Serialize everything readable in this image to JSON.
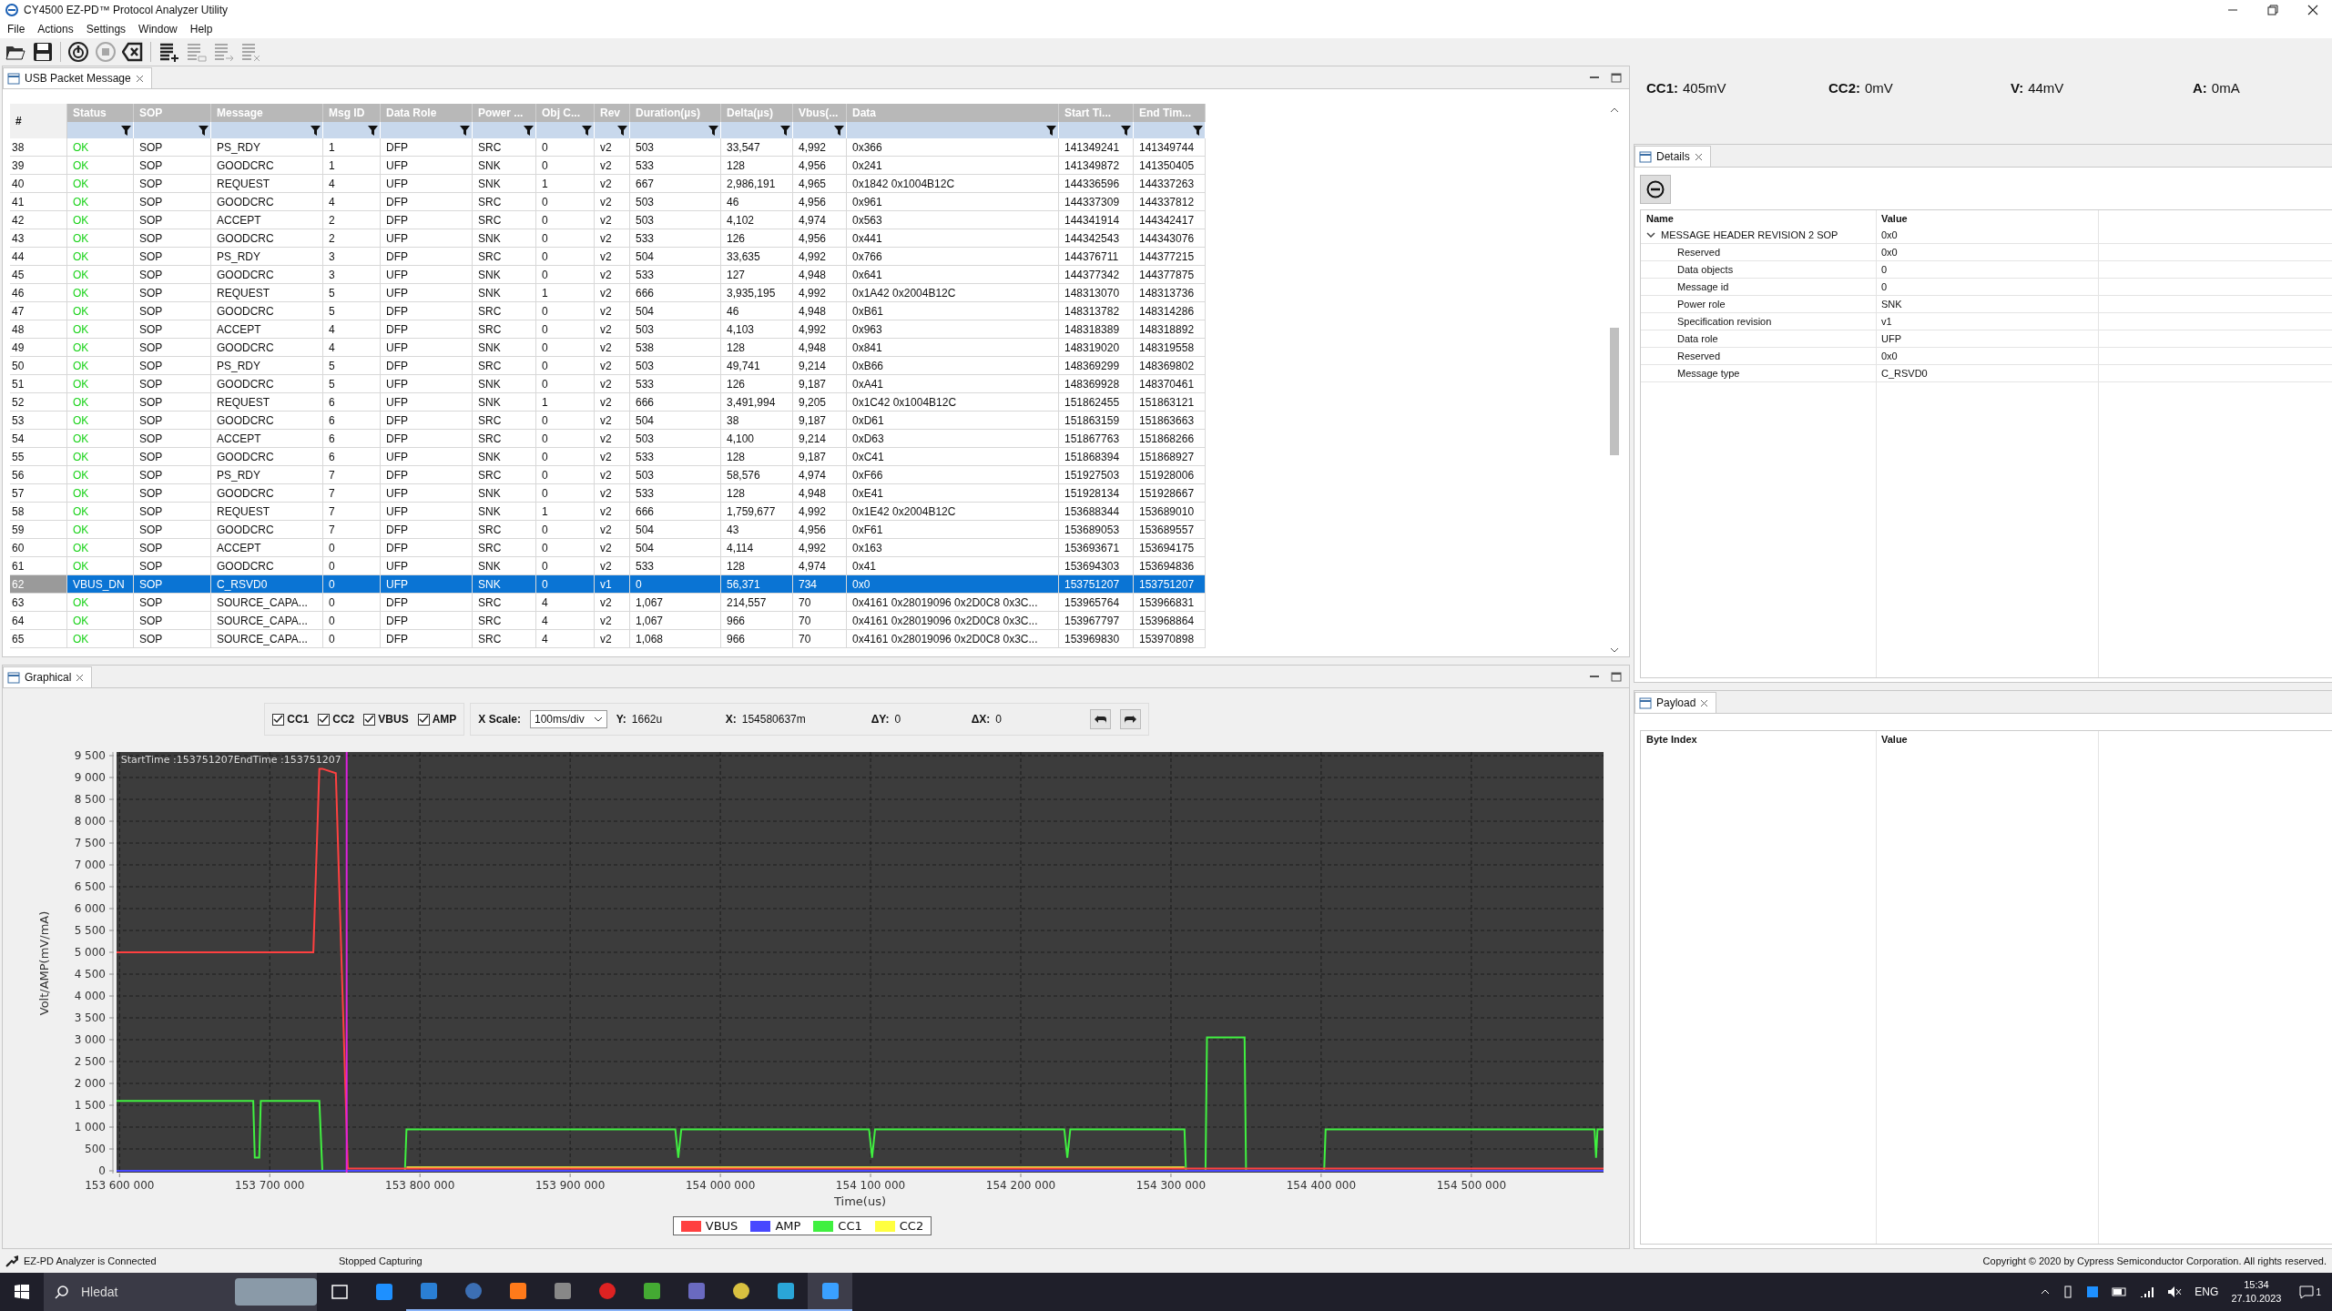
{
  "window": {
    "title": "CY4500 EZ-PD™ Protocol Analyzer Utility"
  },
  "menu": [
    "File",
    "Actions",
    "Settings",
    "Window",
    "Help"
  ],
  "toolbar": [
    {
      "disabled": false
    },
    {
      "disabled": false
    },
    {
      "disabled": false
    },
    {
      "disabled": true
    },
    {
      "disabled": false
    },
    {
      "disabled": false
    },
    {
      "disabled": true
    },
    {
      "disabled": true
    },
    {
      "disabled": true
    }
  ],
  "packet_panel": {
    "tab": "USB Packet Message",
    "table": {
      "columns": [
        "#",
        "Status",
        "SOP",
        "Message",
        "Msg ID",
        "Data Role",
        "Power ...",
        "Obj C...",
        "Rev",
        "Duration(µs)",
        "Delta(µs)",
        "Vbus(...",
        "Data",
        "Start Ti...",
        "End Tim..."
      ],
      "rows": [
        {
          "selected": false,
          "cells": [
            "38",
            "OK",
            "SOP",
            "PS_RDY",
            "1",
            "DFP",
            "SRC",
            "0",
            "v2",
            "503",
            "33,547",
            "4,992",
            "0x366",
            "141349241",
            "141349744"
          ]
        },
        {
          "selected": false,
          "cells": [
            "39",
            "OK",
            "SOP",
            "GOODCRC",
            "1",
            "UFP",
            "SNK",
            "0",
            "v2",
            "533",
            "128",
            "4,956",
            "0x241",
            "141349872",
            "141350405"
          ]
        },
        {
          "selected": false,
          "cells": [
            "40",
            "OK",
            "SOP",
            "REQUEST",
            "4",
            "UFP",
            "SNK",
            "1",
            "v2",
            "667",
            "2,986,191",
            "4,965",
            "0x1842 0x1004B12C",
            "144336596",
            "144337263"
          ]
        },
        {
          "selected": false,
          "cells": [
            "41",
            "OK",
            "SOP",
            "GOODCRC",
            "4",
            "DFP",
            "SRC",
            "0",
            "v2",
            "503",
            "46",
            "4,956",
            "0x961",
            "144337309",
            "144337812"
          ]
        },
        {
          "selected": false,
          "cells": [
            "42",
            "OK",
            "SOP",
            "ACCEPT",
            "2",
            "DFP",
            "SRC",
            "0",
            "v2",
            "503",
            "4,102",
            "4,974",
            "0x563",
            "144341914",
            "144342417"
          ]
        },
        {
          "selected": false,
          "cells": [
            "43",
            "OK",
            "SOP",
            "GOODCRC",
            "2",
            "UFP",
            "SNK",
            "0",
            "v2",
            "533",
            "126",
            "4,956",
            "0x441",
            "144342543",
            "144343076"
          ]
        },
        {
          "selected": false,
          "cells": [
            "44",
            "OK",
            "SOP",
            "PS_RDY",
            "3",
            "DFP",
            "SRC",
            "0",
            "v2",
            "504",
            "33,635",
            "4,992",
            "0x766",
            "144376711",
            "144377215"
          ]
        },
        {
          "selected": false,
          "cells": [
            "45",
            "OK",
            "SOP",
            "GOODCRC",
            "3",
            "UFP",
            "SNK",
            "0",
            "v2",
            "533",
            "127",
            "4,948",
            "0x641",
            "144377342",
            "144377875"
          ]
        },
        {
          "selected": false,
          "cells": [
            "46",
            "OK",
            "SOP",
            "REQUEST",
            "5",
            "UFP",
            "SNK",
            "1",
            "v2",
            "666",
            "3,935,195",
            "4,992",
            "0x1A42 0x2004B12C",
            "148313070",
            "148313736"
          ]
        },
        {
          "selected": false,
          "cells": [
            "47",
            "OK",
            "SOP",
            "GOODCRC",
            "5",
            "DFP",
            "SRC",
            "0",
            "v2",
            "504",
            "46",
            "4,948",
            "0xB61",
            "148313782",
            "148314286"
          ]
        },
        {
          "selected": false,
          "cells": [
            "48",
            "OK",
            "SOP",
            "ACCEPT",
            "4",
            "DFP",
            "SRC",
            "0",
            "v2",
            "503",
            "4,103",
            "4,992",
            "0x963",
            "148318389",
            "148318892"
          ]
        },
        {
          "selected": false,
          "cells": [
            "49",
            "OK",
            "SOP",
            "GOODCRC",
            "4",
            "UFP",
            "SNK",
            "0",
            "v2",
            "538",
            "128",
            "4,948",
            "0x841",
            "148319020",
            "148319558"
          ]
        },
        {
          "selected": false,
          "cells": [
            "50",
            "OK",
            "SOP",
            "PS_RDY",
            "5",
            "DFP",
            "SRC",
            "0",
            "v2",
            "503",
            "49,741",
            "9,214",
            "0xB66",
            "148369299",
            "148369802"
          ]
        },
        {
          "selected": false,
          "cells": [
            "51",
            "OK",
            "SOP",
            "GOODCRC",
            "5",
            "UFP",
            "SNK",
            "0",
            "v2",
            "533",
            "126",
            "9,187",
            "0xA41",
            "148369928",
            "148370461"
          ]
        },
        {
          "selected": false,
          "cells": [
            "52",
            "OK",
            "SOP",
            "REQUEST",
            "6",
            "UFP",
            "SNK",
            "1",
            "v2",
            "666",
            "3,491,994",
            "9,205",
            "0x1C42 0x1004B12C",
            "151862455",
            "151863121"
          ]
        },
        {
          "selected": false,
          "cells": [
            "53",
            "OK",
            "SOP",
            "GOODCRC",
            "6",
            "DFP",
            "SRC",
            "0",
            "v2",
            "504",
            "38",
            "9,187",
            "0xD61",
            "151863159",
            "151863663"
          ]
        },
        {
          "selected": false,
          "cells": [
            "54",
            "OK",
            "SOP",
            "ACCEPT",
            "6",
            "DFP",
            "SRC",
            "0",
            "v2",
            "503",
            "4,100",
            "9,214",
            "0xD63",
            "151867763",
            "151868266"
          ]
        },
        {
          "selected": false,
          "cells": [
            "55",
            "OK",
            "SOP",
            "GOODCRC",
            "6",
            "UFP",
            "SNK",
            "0",
            "v2",
            "533",
            "128",
            "9,187",
            "0xC41",
            "151868394",
            "151868927"
          ]
        },
        {
          "selected": false,
          "cells": [
            "56",
            "OK",
            "SOP",
            "PS_RDY",
            "7",
            "DFP",
            "SRC",
            "0",
            "v2",
            "503",
            "58,576",
            "4,974",
            "0xF66",
            "151927503",
            "151928006"
          ]
        },
        {
          "selected": false,
          "cells": [
            "57",
            "OK",
            "SOP",
            "GOODCRC",
            "7",
            "UFP",
            "SNK",
            "0",
            "v2",
            "533",
            "128",
            "4,948",
            "0xE41",
            "151928134",
            "151928667"
          ]
        },
        {
          "selected": false,
          "cells": [
            "58",
            "OK",
            "SOP",
            "REQUEST",
            "7",
            "UFP",
            "SNK",
            "1",
            "v2",
            "666",
            "1,759,677",
            "4,992",
            "0x1E42 0x2004B12C",
            "153688344",
            "153689010"
          ]
        },
        {
          "selected": false,
          "cells": [
            "59",
            "OK",
            "SOP",
            "GOODCRC",
            "7",
            "DFP",
            "SRC",
            "0",
            "v2",
            "504",
            "43",
            "4,956",
            "0xF61",
            "153689053",
            "153689557"
          ]
        },
        {
          "selected": false,
          "cells": [
            "60",
            "OK",
            "SOP",
            "ACCEPT",
            "0",
            "DFP",
            "SRC",
            "0",
            "v2",
            "504",
            "4,114",
            "4,992",
            "0x163",
            "153693671",
            "153694175"
          ]
        },
        {
          "selected": false,
          "cells": [
            "61",
            "OK",
            "SOP",
            "GOODCRC",
            "0",
            "UFP",
            "SNK",
            "0",
            "v2",
            "533",
            "128",
            "4,974",
            "0x41",
            "153694303",
            "153694836"
          ]
        },
        {
          "selected": true,
          "cells": [
            "62",
            "VBUS_DN",
            "SOP",
            "C_RSVD0",
            "0",
            "UFP",
            "SNK",
            "0",
            "v1",
            "0",
            "56,371",
            "734",
            "0x0",
            "153751207",
            "153751207"
          ]
        },
        {
          "selected": false,
          "cells": [
            "63",
            "OK",
            "SOP",
            "SOURCE_CAPA...",
            "0",
            "DFP",
            "SRC",
            "4",
            "v2",
            "1,067",
            "214,557",
            "70",
            "0x4161 0x28019096 0x2D0C8 0x3C...",
            "153965764",
            "153966831"
          ]
        },
        {
          "selected": false,
          "cells": [
            "64",
            "OK",
            "SOP",
            "SOURCE_CAPA...",
            "0",
            "DFP",
            "SRC",
            "4",
            "v2",
            "1,067",
            "966",
            "70",
            "0x4161 0x28019096 0x2D0C8 0x3C...",
            "153967797",
            "153968864"
          ]
        },
        {
          "selected": false,
          "cells": [
            "65",
            "OK",
            "SOP",
            "SOURCE_CAPA...",
            "0",
            "DFP",
            "SRC",
            "4",
            "v2",
            "1,068",
            "966",
            "70",
            "0x4161 0x28019096 0x2D0C8 0x3C...",
            "153969830",
            "153970898"
          ]
        }
      ]
    }
  },
  "graphical": {
    "tab": "Graphical",
    "channels": [
      {
        "label": "CC1",
        "checked": true
      },
      {
        "label": "CC2",
        "checked": true
      },
      {
        "label": "VBUS",
        "checked": true
      },
      {
        "label": "AMP",
        "checked": true
      }
    ],
    "x_scale_label": "X Scale:",
    "x_scale": "100ms/div",
    "readouts": [
      {
        "label": "Y:",
        "value": "1662u"
      },
      {
        "label": "X:",
        "value": "154580637m"
      },
      {
        "label": "ΔY:",
        "value": "0"
      },
      {
        "label": "ΔX:",
        "value": "0"
      }
    ],
    "chart_data": {
      "type": "line",
      "xlabel": "Time(us)",
      "ylabel": "Volt/AMP(mV/mA)",
      "xlim": [
        153598000,
        154588000
      ],
      "ylim": [
        0,
        9500
      ],
      "x": [
        153598000,
        153689000,
        153690000,
        153693000,
        153694000,
        153729000,
        153733000,
        153735000,
        153744000,
        153752000,
        153790000,
        153791000,
        153970000,
        153972000,
        153974000,
        154099000,
        154101000,
        154103000,
        154229000,
        154231000,
        154233000,
        154309000,
        154310000,
        154323000,
        154324000,
        154349000,
        154350000,
        154402000,
        154403000,
        154582000,
        154583000,
        154584000,
        154588000
      ],
      "series": [
        {
          "name": "VBUS",
          "color": "#ff4040",
          "values": [
            5000,
            5000,
            5000,
            5000,
            5000,
            5000,
            9200,
            9200,
            9100,
            50,
            50,
            50,
            50,
            50,
            50,
            50,
            50,
            50,
            50,
            50,
            50,
            50,
            50,
            50,
            50,
            50,
            50,
            50,
            50,
            50,
            50,
            50,
            50
          ]
        },
        {
          "name": "AMP",
          "color": "#4848ff",
          "values": [
            0,
            0,
            0,
            0,
            0,
            0,
            0,
            0,
            0,
            0,
            0,
            0,
            0,
            0,
            0,
            0,
            0,
            0,
            0,
            0,
            0,
            0,
            0,
            0,
            0,
            0,
            0,
            0,
            0,
            0,
            0,
            0,
            0
          ]
        },
        {
          "name": "CC1",
          "color": "#40f040",
          "values": [
            1600,
            1600,
            300,
            300,
            1600,
            1600,
            1600,
            0,
            0,
            0,
            0,
            950,
            950,
            300,
            950,
            950,
            300,
            950,
            950,
            300,
            950,
            950,
            0,
            0,
            3050,
            3050,
            0,
            0,
            950,
            950,
            300,
            950,
            950
          ]
        },
        {
          "name": "CC2",
          "color": "#ffff40",
          "values": [
            null,
            null,
            null,
            null,
            null,
            null,
            null,
            null,
            null,
            null,
            null,
            80,
            80,
            80,
            80,
            80,
            80,
            80,
            80,
            80,
            80,
            80,
            null,
            null,
            null,
            null,
            null,
            null,
            null,
            null,
            null,
            null,
            null
          ]
        }
      ],
      "xticks": [
        {
          "value": 153600000,
          "label": "153 600 000"
        },
        {
          "value": 153700000,
          "label": "153 700 000"
        },
        {
          "value": 153800000,
          "label": "153 800 000"
        },
        {
          "value": 153900000,
          "label": "153 900 000"
        },
        {
          "value": 154000000,
          "label": "154 000 000"
        },
        {
          "value": 154100000,
          "label": "154 100 000"
        },
        {
          "value": 154200000,
          "label": "154 200 000"
        },
        {
          "value": 154300000,
          "label": "154 300 000"
        },
        {
          "value": 154400000,
          "label": "154 400 000"
        },
        {
          "value": 154500000,
          "label": "154 500 000"
        }
      ],
      "yticks": [
        {
          "value": 0,
          "label": "0"
        },
        {
          "value": 500,
          "label": "500"
        },
        {
          "value": 1000,
          "label": "1 000"
        },
        {
          "value": 1500,
          "label": "1 500"
        },
        {
          "value": 2000,
          "label": "2 000"
        },
        {
          "value": 2500,
          "label": "2 500"
        },
        {
          "value": 3000,
          "label": "3 000"
        },
        {
          "value": 3500,
          "label": "3 500"
        },
        {
          "value": 4000,
          "label": "4 000"
        },
        {
          "value": 4500,
          "label": "4 500"
        },
        {
          "value": 5000,
          "label": "5 000"
        },
        {
          "value": 5500,
          "label": "5 500"
        },
        {
          "value": 6000,
          "label": "6 000"
        },
        {
          "value": 6500,
          "label": "6 500"
        },
        {
          "value": 7000,
          "label": "7 000"
        },
        {
          "value": 7500,
          "label": "7 500"
        },
        {
          "value": 8000,
          "label": "8 000"
        },
        {
          "value": 8500,
          "label": "8 500"
        },
        {
          "value": 9000,
          "label": "9 000"
        },
        {
          "value": 9500,
          "label": "9 500"
        }
      ],
      "grid": true,
      "legend": true,
      "ref_lines": [
        {
          "axis": "x",
          "value": 153751207,
          "color": "#e020e0"
        }
      ],
      "annotations": [
        {
          "text": "StartTime :153751207EndTime :153751207"
        }
      ]
    }
  },
  "meters": [
    {
      "label": "CC1:",
      "value": "405mV"
    },
    {
      "label": "CC2:",
      "value": "0mV"
    },
    {
      "label": "V:",
      "value": "44mV"
    },
    {
      "label": "A:",
      "value": "0mA"
    }
  ],
  "details": {
    "tab": "Details",
    "columns": [
      "Name",
      "Value"
    ],
    "tree": [
      {
        "name": "MESSAGE HEADER REVISION 2 SOP",
        "value": "0x0",
        "expanded": true,
        "children": [
          {
            "name": "Reserved",
            "value": "0x0"
          },
          {
            "name": "Data objects",
            "value": "0"
          },
          {
            "name": "Message id",
            "value": "0"
          },
          {
            "name": "Power role",
            "value": "SNK"
          },
          {
            "name": "Specification revision",
            "value": "v1"
          },
          {
            "name": "Data role",
            "value": "UFP"
          },
          {
            "name": "Reserved",
            "value": "0x0"
          },
          {
            "name": "Message type",
            "value": "C_RSVD0"
          }
        ]
      }
    ]
  },
  "payload": {
    "tab": "Payload",
    "columns": [
      "Byte Index",
      "Value"
    ]
  },
  "status_bar": {
    "connection": "EZ-PD Analyzer is Connected",
    "capture": "Stopped Capturing",
    "copyright": "Copyright © 2020 by Cypress Semiconductor Corporation. All rights reserved."
  },
  "taskbar": {
    "search_placeholder": "Hledat",
    "language": "ENG",
    "time": "15:34",
    "date": "27.10.2023",
    "notifications": "1"
  }
}
